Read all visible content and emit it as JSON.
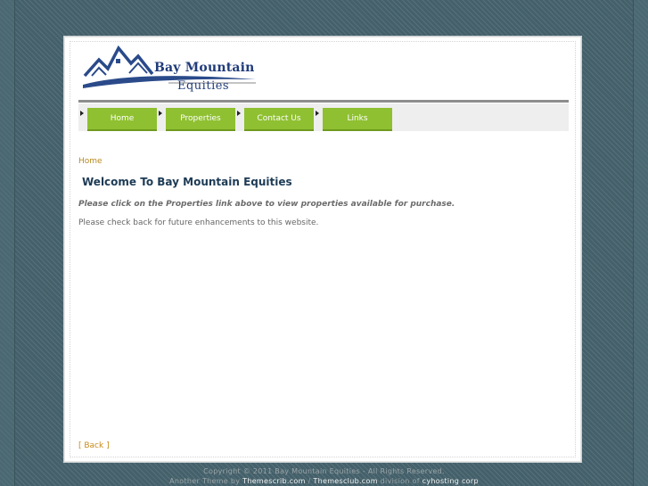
{
  "logo": {
    "name": "Bay Mountain",
    "sub": "Equities"
  },
  "menu": {
    "items": [
      {
        "label": "Home"
      },
      {
        "label": "Properties"
      },
      {
        "label": "Contact Us"
      },
      {
        "label": "Links"
      }
    ]
  },
  "content": {
    "breadcrumb": "Home",
    "title": "Welcome To Bay Mountain Equities",
    "lead": "Please click on the Properties link above to view properties available for purchase.",
    "body": "Please check back for future enhancements to this website.",
    "back": "[ Back ]"
  },
  "footer": {
    "copyright": "Copyright © 2011 Bay Mountain Equities  -  All Rights Reserved.",
    "another_theme": "Another Theme by",
    "link1": "Themescrib.com",
    "separator": "/",
    "link2": "Themesclub.com",
    "division_of": "division of",
    "link3": "cyhosting corp"
  },
  "colors": {
    "menu_green": "#8fc031",
    "title_blue": "#1d3b55",
    "logo_blue": "#1f3b7a",
    "link_orange": "#c98a1a"
  }
}
